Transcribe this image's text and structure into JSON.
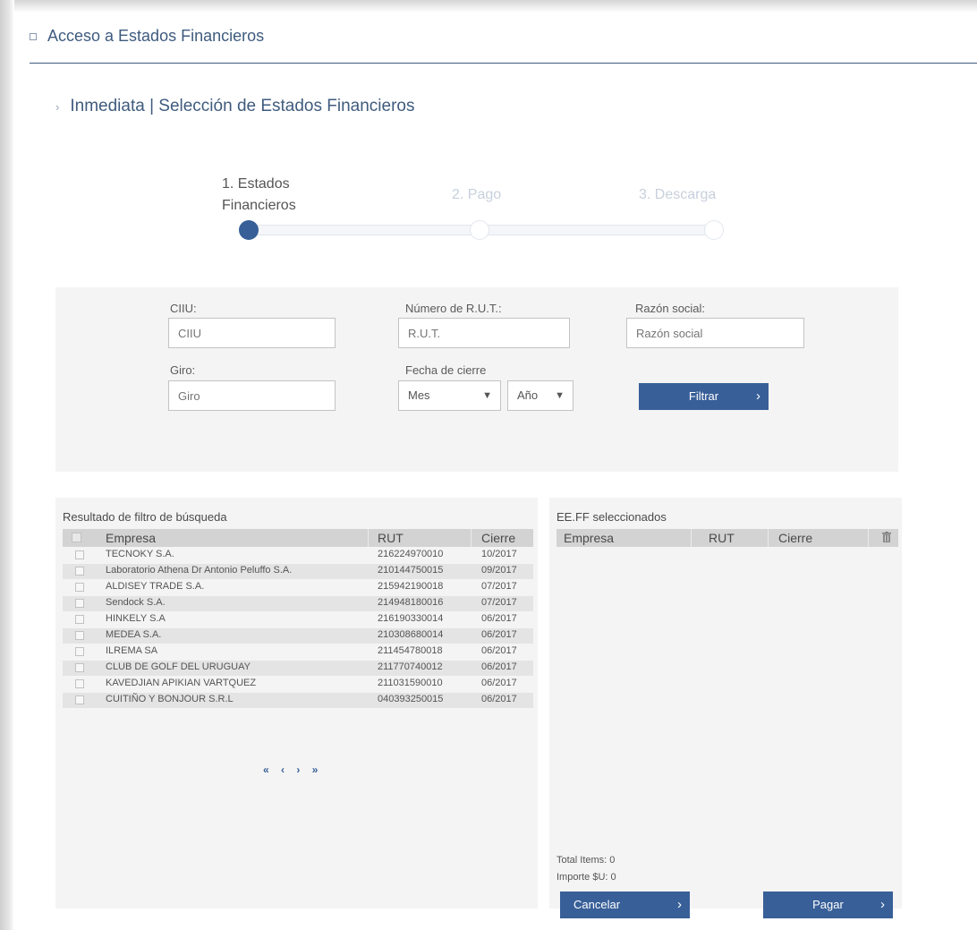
{
  "header": {
    "title": "Acceso a Estados Financieros"
  },
  "section": {
    "title": "Inmediata | Selección de Estados Financieros"
  },
  "steps": [
    {
      "line1": "1. Estados",
      "line2": "Financieros",
      "active": true
    },
    {
      "line1": "2. Pago",
      "active": false
    },
    {
      "line1": "3. Descarga",
      "active": false
    }
  ],
  "filters": {
    "ciiu": {
      "label": "CIIU:",
      "placeholder": "CIIU"
    },
    "rut": {
      "label": "Número de R.U.T.:",
      "placeholder": "R.U.T."
    },
    "razon": {
      "label": "Razón social:",
      "placeholder": "Razón social"
    },
    "giro": {
      "label": "Giro:",
      "placeholder": "Giro"
    },
    "fecha": {
      "label": "Fecha de cierre",
      "mes": "Mes",
      "anio": "Año"
    },
    "filter_button": "Filtrar"
  },
  "results": {
    "title": "Resultado de filtro de búsqueda",
    "columns": [
      "Empresa",
      "RUT",
      "Cierre"
    ],
    "rows": [
      {
        "empresa": "TECNOKY S.A.",
        "rut": "216224970010",
        "cierre": "10/2017"
      },
      {
        "empresa": "Laboratorio Athena Dr Antonio Peluffo S.A.",
        "rut": "210144750015",
        "cierre": "09/2017"
      },
      {
        "empresa": "ALDISEY TRADE S.A.",
        "rut": "215942190018",
        "cierre": "07/2017"
      },
      {
        "empresa": "Sendock S.A.",
        "rut": "214948180016",
        "cierre": "07/2017"
      },
      {
        "empresa": "HINKELY S.A",
        "rut": "216190330014",
        "cierre": "06/2017"
      },
      {
        "empresa": "MEDEA S.A.",
        "rut": "210308680014",
        "cierre": "06/2017"
      },
      {
        "empresa": "ILREMA SA",
        "rut": "211454780018",
        "cierre": "06/2017"
      },
      {
        "empresa": "CLUB DE GOLF DEL URUGUAY",
        "rut": "211770740012",
        "cierre": "06/2017"
      },
      {
        "empresa": "KAVEDJIAN APIKIAN VARTQUEZ",
        "rut": "211031590010",
        "cierre": "06/2017"
      },
      {
        "empresa": "CUITIÑO Y BONJOUR S.R.L",
        "rut": "040393250015",
        "cierre": "06/2017"
      }
    ],
    "pager": {
      "first": "«",
      "prev": "‹",
      "next": "›",
      "last": "»"
    }
  },
  "selected": {
    "title": "EE.FF seleccionados",
    "columns": [
      "Empresa",
      "RUT",
      "Cierre"
    ],
    "total_items": "Total Items: 0",
    "importe": "Importe $U: 0",
    "cancel_button": "Cancelar",
    "pay_button": "Pagar"
  },
  "colors": {
    "primary": "#385f98",
    "title": "#3f5b7e",
    "panel": "#f4f4f4",
    "header_row": "#d3d3d3"
  }
}
